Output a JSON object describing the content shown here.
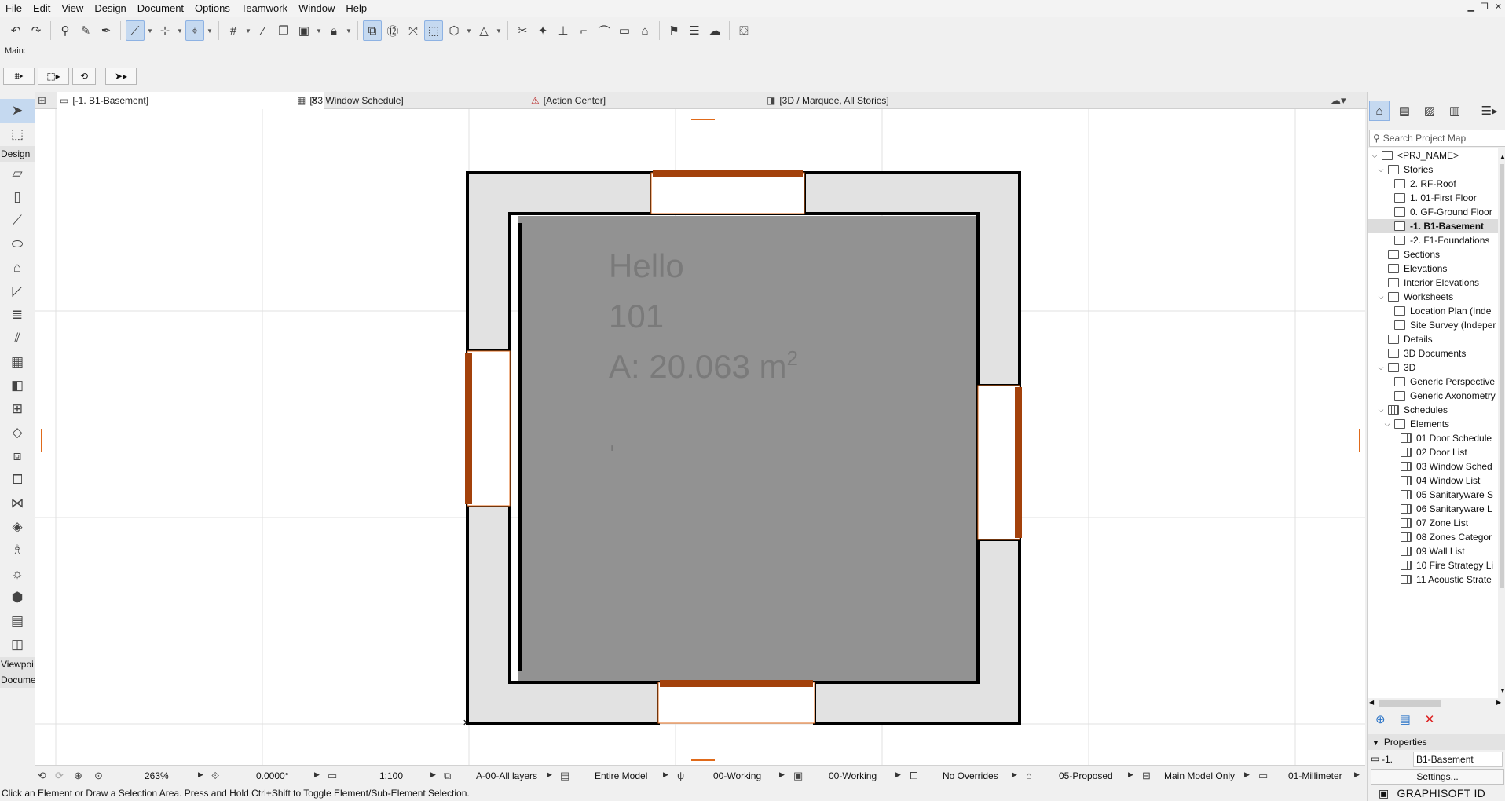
{
  "menubar": {
    "items": [
      "File",
      "Edit",
      "View",
      "Design",
      "Document",
      "Options",
      "Teamwork",
      "Window",
      "Help"
    ]
  },
  "infobox": {
    "label": "Main:"
  },
  "toolbox": {
    "design_label": "Design",
    "viewpoint_label": "Viewpoi",
    "document_label": "Docume"
  },
  "tabs": [
    {
      "label": "[-1. B1-Basement]",
      "icon": "floor-plan-icon",
      "active": true
    },
    {
      "label": "[03 Window Schedule]",
      "icon": "schedule-icon",
      "active": false
    },
    {
      "label": "[Action Center]",
      "icon": "action-center-icon",
      "active": false
    },
    {
      "label": "[3D / Marquee, All Stories]",
      "icon": "3d-icon",
      "active": false
    }
  ],
  "zone": {
    "name": "Hello",
    "number": "101",
    "area": "A: 20.063 m",
    "area_exp": "2"
  },
  "statusbar": {
    "zoom": "263%",
    "angle": "0.0000°",
    "scale": "1:100",
    "layers": "A-00-All layers",
    "model_view": "Entire Model",
    "pen_set": "00-Working",
    "mvo": "00-Working",
    "overrides": "No Overrides",
    "renovation": "05-Proposed",
    "filter": "Main Model Only",
    "dimension": "01-Millimeter"
  },
  "hint": "Click an Element or Draw a Selection Area. Press and Hold Ctrl+Shift to Toggle Element/Sub-Element Selection.",
  "navigator": {
    "search_placeholder": "Search Project Map",
    "tree": [
      {
        "label": "<PRJ_NAME>",
        "depth": 0,
        "chev": "v",
        "icon": "building-icon"
      },
      {
        "label": "Stories",
        "depth": 1,
        "chev": "v",
        "icon": "stories-icon"
      },
      {
        "label": "2. RF-Roof",
        "depth": 2,
        "chev": "",
        "icon": "story-icon"
      },
      {
        "label": "1. 01-First Floor",
        "depth": 2,
        "chev": "",
        "icon": "story-icon"
      },
      {
        "label": "0. GF-Ground Floor",
        "depth": 2,
        "chev": "",
        "icon": "story-icon"
      },
      {
        "label": "-1. B1-Basement",
        "depth": 2,
        "chev": "",
        "icon": "story-icon",
        "selected": true
      },
      {
        "label": "-2. F1-Foundations",
        "depth": 2,
        "chev": "",
        "icon": "story-icon"
      },
      {
        "label": "Sections",
        "depth": 1,
        "chev": "",
        "icon": "section-icon"
      },
      {
        "label": "Elevations",
        "depth": 1,
        "chev": "",
        "icon": "elevation-icon"
      },
      {
        "label": "Interior Elevations",
        "depth": 1,
        "chev": "",
        "icon": "interior-elevation-icon"
      },
      {
        "label": "Worksheets",
        "depth": 1,
        "chev": "v",
        "icon": "worksheet-icon"
      },
      {
        "label": "Location Plan (Inde",
        "depth": 2,
        "chev": "",
        "icon": "worksheet-icon"
      },
      {
        "label": "Site Survey (Indeper",
        "depth": 2,
        "chev": "",
        "icon": "worksheet-icon"
      },
      {
        "label": "Details",
        "depth": 1,
        "chev": "",
        "icon": "detail-icon"
      },
      {
        "label": "3D Documents",
        "depth": 1,
        "chev": "",
        "icon": "3d-document-icon"
      },
      {
        "label": "3D",
        "depth": 1,
        "chev": "v",
        "icon": "3d-icon"
      },
      {
        "label": "Generic Perspective",
        "depth": 2,
        "chev": "",
        "icon": "perspective-icon"
      },
      {
        "label": "Generic Axonometry",
        "depth": 2,
        "chev": "",
        "icon": "axonometry-icon"
      },
      {
        "label": "Schedules",
        "depth": 1,
        "chev": "v",
        "icon": "schedule-icon"
      },
      {
        "label": "Elements",
        "depth": 2,
        "chev": "v",
        "icon": "elements-icon"
      },
      {
        "label": "01 Door Schedule",
        "depth": 3,
        "chev": "",
        "icon": "schedule-icon"
      },
      {
        "label": "02 Door List",
        "depth": 3,
        "chev": "",
        "icon": "schedule-icon"
      },
      {
        "label": "03 Window Sched",
        "depth": 3,
        "chev": "",
        "icon": "schedule-icon"
      },
      {
        "label": "04 Window List",
        "depth": 3,
        "chev": "",
        "icon": "schedule-icon"
      },
      {
        "label": "05 Sanitaryware S",
        "depth": 3,
        "chev": "",
        "icon": "schedule-icon"
      },
      {
        "label": "06 Sanitaryware L",
        "depth": 3,
        "chev": "",
        "icon": "schedule-icon"
      },
      {
        "label": "07 Zone List",
        "depth": 3,
        "chev": "",
        "icon": "schedule-icon"
      },
      {
        "label": "08 Zones Categor",
        "depth": 3,
        "chev": "",
        "icon": "schedule-icon"
      },
      {
        "label": "09 Wall List",
        "depth": 3,
        "chev": "",
        "icon": "schedule-icon"
      },
      {
        "label": "10 Fire Strategy Li",
        "depth": 3,
        "chev": "",
        "icon": "schedule-icon"
      },
      {
        "label": "11 Acoustic Strate",
        "depth": 3,
        "chev": "",
        "icon": "schedule-icon"
      }
    ],
    "properties_label": "Properties",
    "prop_id": "-1.",
    "prop_name": "B1-Basement",
    "settings_label": "Settings...",
    "brand": "GRAPHISOFT ID"
  },
  "colors": {
    "door": "#a3410b",
    "door_outline": "#e06a1a",
    "zone_fill": "#929292",
    "wall_fill": "#e2e2e2",
    "select": "#c5d9f0"
  }
}
